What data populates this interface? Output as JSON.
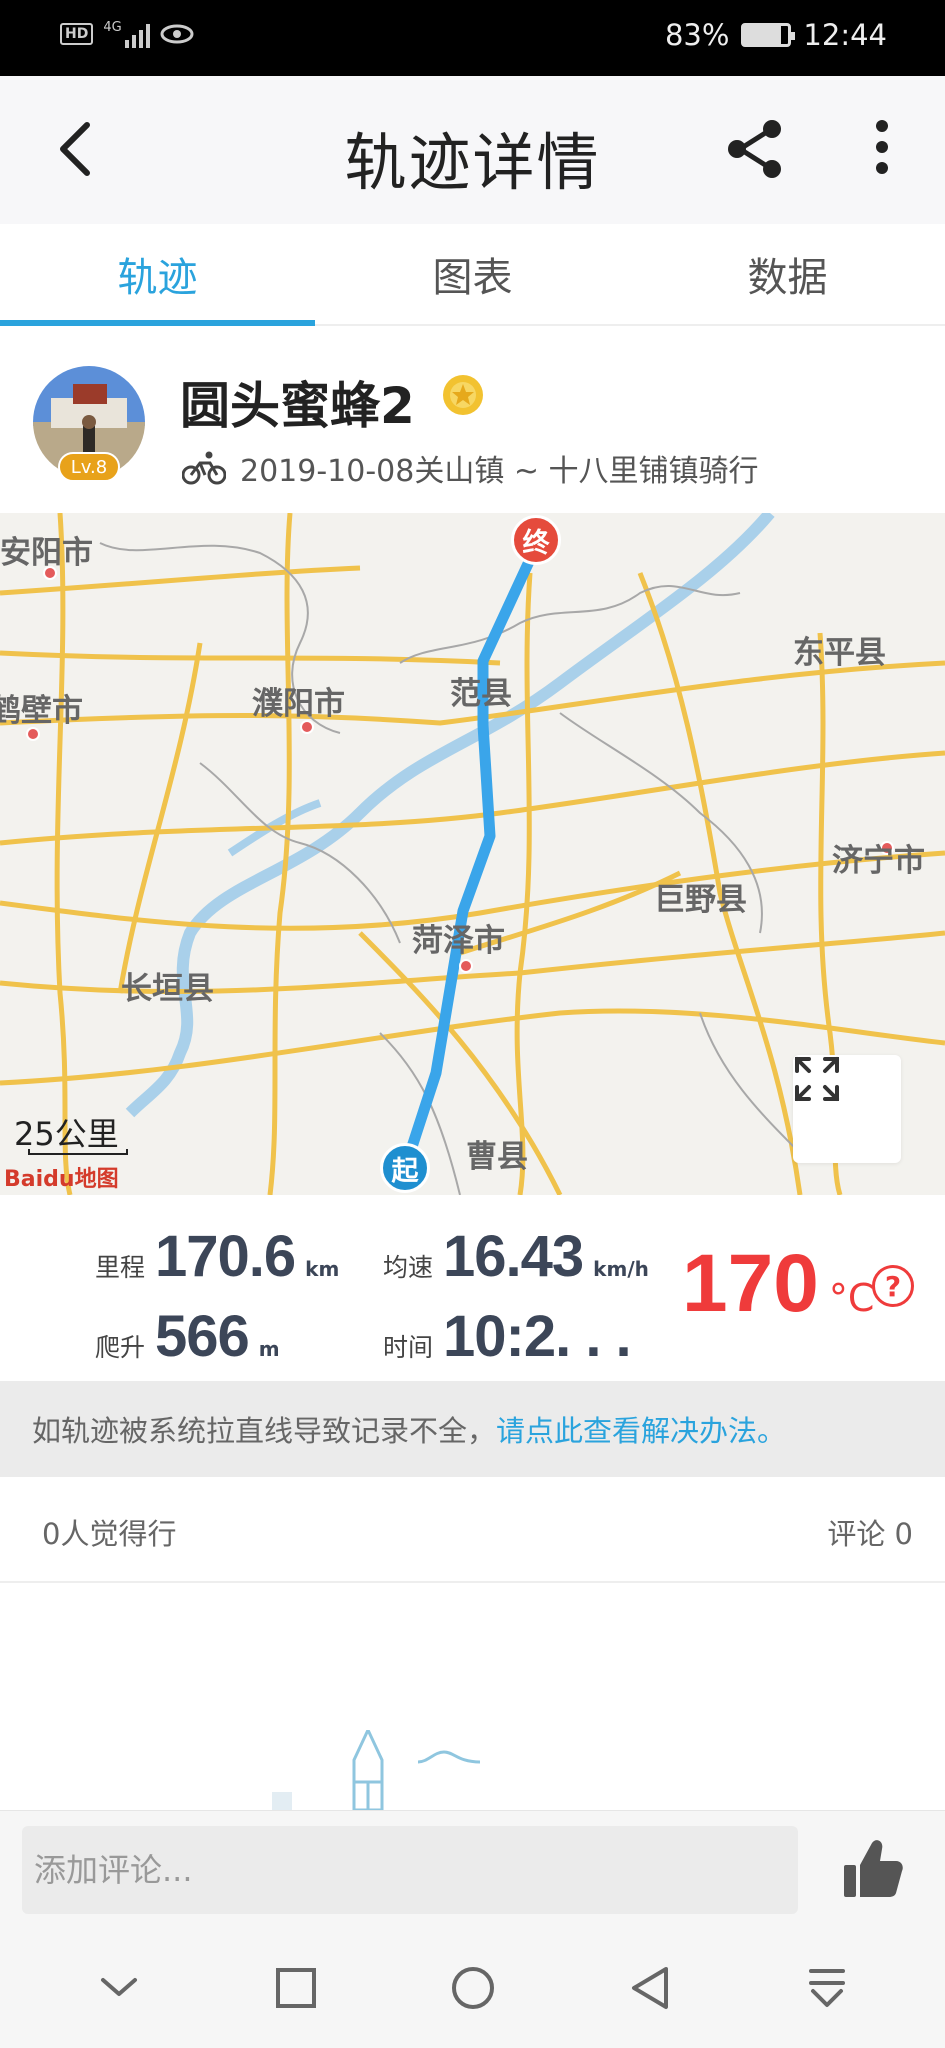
{
  "status_bar": {
    "network": "4G",
    "hd_label": "HD",
    "battery_percent": "83%",
    "battery_level": 0.83,
    "time": "12:44"
  },
  "app_bar": {
    "title": "轨迹详情",
    "back_icon": "back-arrow-icon",
    "share_icon": "share-icon",
    "more_icon": "more-vertical-icon"
  },
  "tabs": [
    {
      "label": "轨迹",
      "active": true
    },
    {
      "label": "图表",
      "active": false
    },
    {
      "label": "数据",
      "active": false
    }
  ],
  "profile": {
    "username": "圆头蜜蜂2",
    "level": "Lv.8",
    "ride_description": "2019-10-08关山镇 ~ 十八里铺镇骑行"
  },
  "map": {
    "cities": [
      {
        "name": "安阳市"
      },
      {
        "name": "鹤壁市"
      },
      {
        "name": "濮阳市"
      },
      {
        "name": "范县"
      },
      {
        "name": "东平县"
      },
      {
        "name": "济宁市"
      },
      {
        "name": "巨野县"
      },
      {
        "name": "菏泽市"
      },
      {
        "name": "长垣县"
      },
      {
        "name": "曹县"
      }
    ],
    "start_marker": "起",
    "end_marker": "终",
    "scale_label": "25公里",
    "logo_text": "Baidu地图",
    "route_color": "#3aa5ea"
  },
  "stats": {
    "distance_label": "里程",
    "distance_value": "170.6",
    "distance_unit": "km",
    "speed_label": "均速",
    "speed_value": "16.43",
    "speed_unit": "km/h",
    "climb_label": "爬升",
    "climb_value": "566",
    "climb_unit": "m",
    "time_label": "时间",
    "time_value": "10:2. . .",
    "temperature_value": "170",
    "temperature_unit": "°C",
    "help_icon": "question-circle-icon"
  },
  "notice": {
    "text": "如轨迹被系统拉直线导致记录不全，",
    "link_text": "请点此查看解决办法。"
  },
  "social": {
    "likes_text": "0人觉得行",
    "comments_text": "评论 0"
  },
  "comment_bar": {
    "placeholder": "添加评论...",
    "like_icon": "thumbs-up-icon"
  },
  "nav_bar": {
    "icons": [
      "chevron-down-icon",
      "square-icon",
      "circle-icon",
      "triangle-back-icon",
      "download-icon"
    ]
  },
  "colors": {
    "accent": "#2aa3dd",
    "temperature": "#ef3b3b",
    "stat_value": "#3c4658"
  }
}
